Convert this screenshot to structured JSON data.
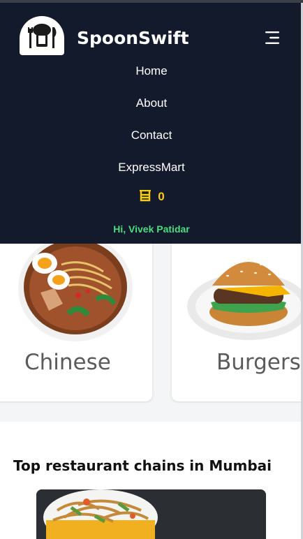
{
  "header": {
    "brand": "SpoonSwift",
    "logo_icon": "chef-hat-icon",
    "menu_icon": "hamburger-menu-icon"
  },
  "nav": {
    "links": [
      "Home",
      "About",
      "Contact",
      "ExpressMart"
    ]
  },
  "cart": {
    "icon": "cart-icon",
    "count": "0"
  },
  "user": {
    "greeting": "Hi, Vivek Patidar"
  },
  "cuisines": [
    {
      "label": "Chinese",
      "image": "noodle-bowl-image"
    },
    {
      "label": "Burgers",
      "image": "burger-image"
    }
  ],
  "section": {
    "title": "Top restaurant chains in Mumbai"
  },
  "colors": {
    "navbar_bg": "#131a2b",
    "cart_accent": "#facc15",
    "greeting_green": "#4ade80",
    "page_bg": "#f4f5f7"
  }
}
